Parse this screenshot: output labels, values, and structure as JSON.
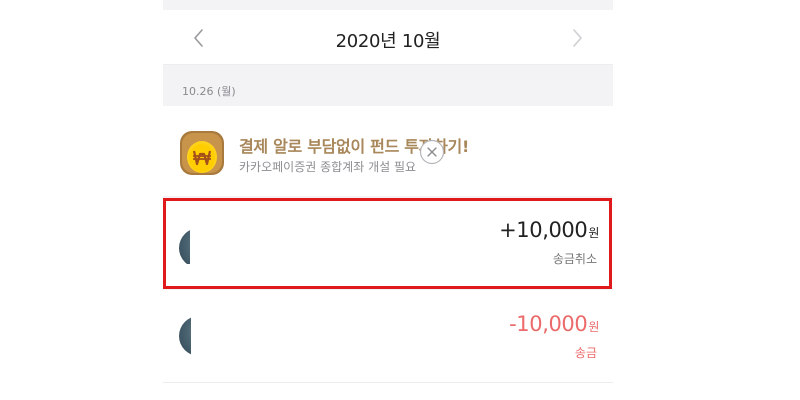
{
  "header": {
    "month_title": "2020년 10월",
    "prev_icon": "chevron-left-icon",
    "next_icon": "chevron-right-icon"
  },
  "date_group": {
    "label": "10.26 (월)"
  },
  "promo": {
    "icon": "won-coin-icon",
    "title": "결제 알로 부담없이 펀드 투자하기!",
    "subtitle": "카카오페이증권 종합계좌 개설 필요",
    "close_icon": "close-icon"
  },
  "transactions": [
    {
      "amount": "+10,000",
      "unit": "원",
      "status": "송금취소",
      "amount_color": "#222222",
      "highlighted": true
    },
    {
      "amount": "-10,000",
      "unit": "원",
      "status": "송금",
      "amount_color": "#ec6a6a",
      "highlighted": false
    }
  ],
  "colors": {
    "accent_gold": "#a8875a",
    "negative": "#ec6a6a",
    "highlight_border": "#e01a1a",
    "background": "#f3f3f5"
  }
}
